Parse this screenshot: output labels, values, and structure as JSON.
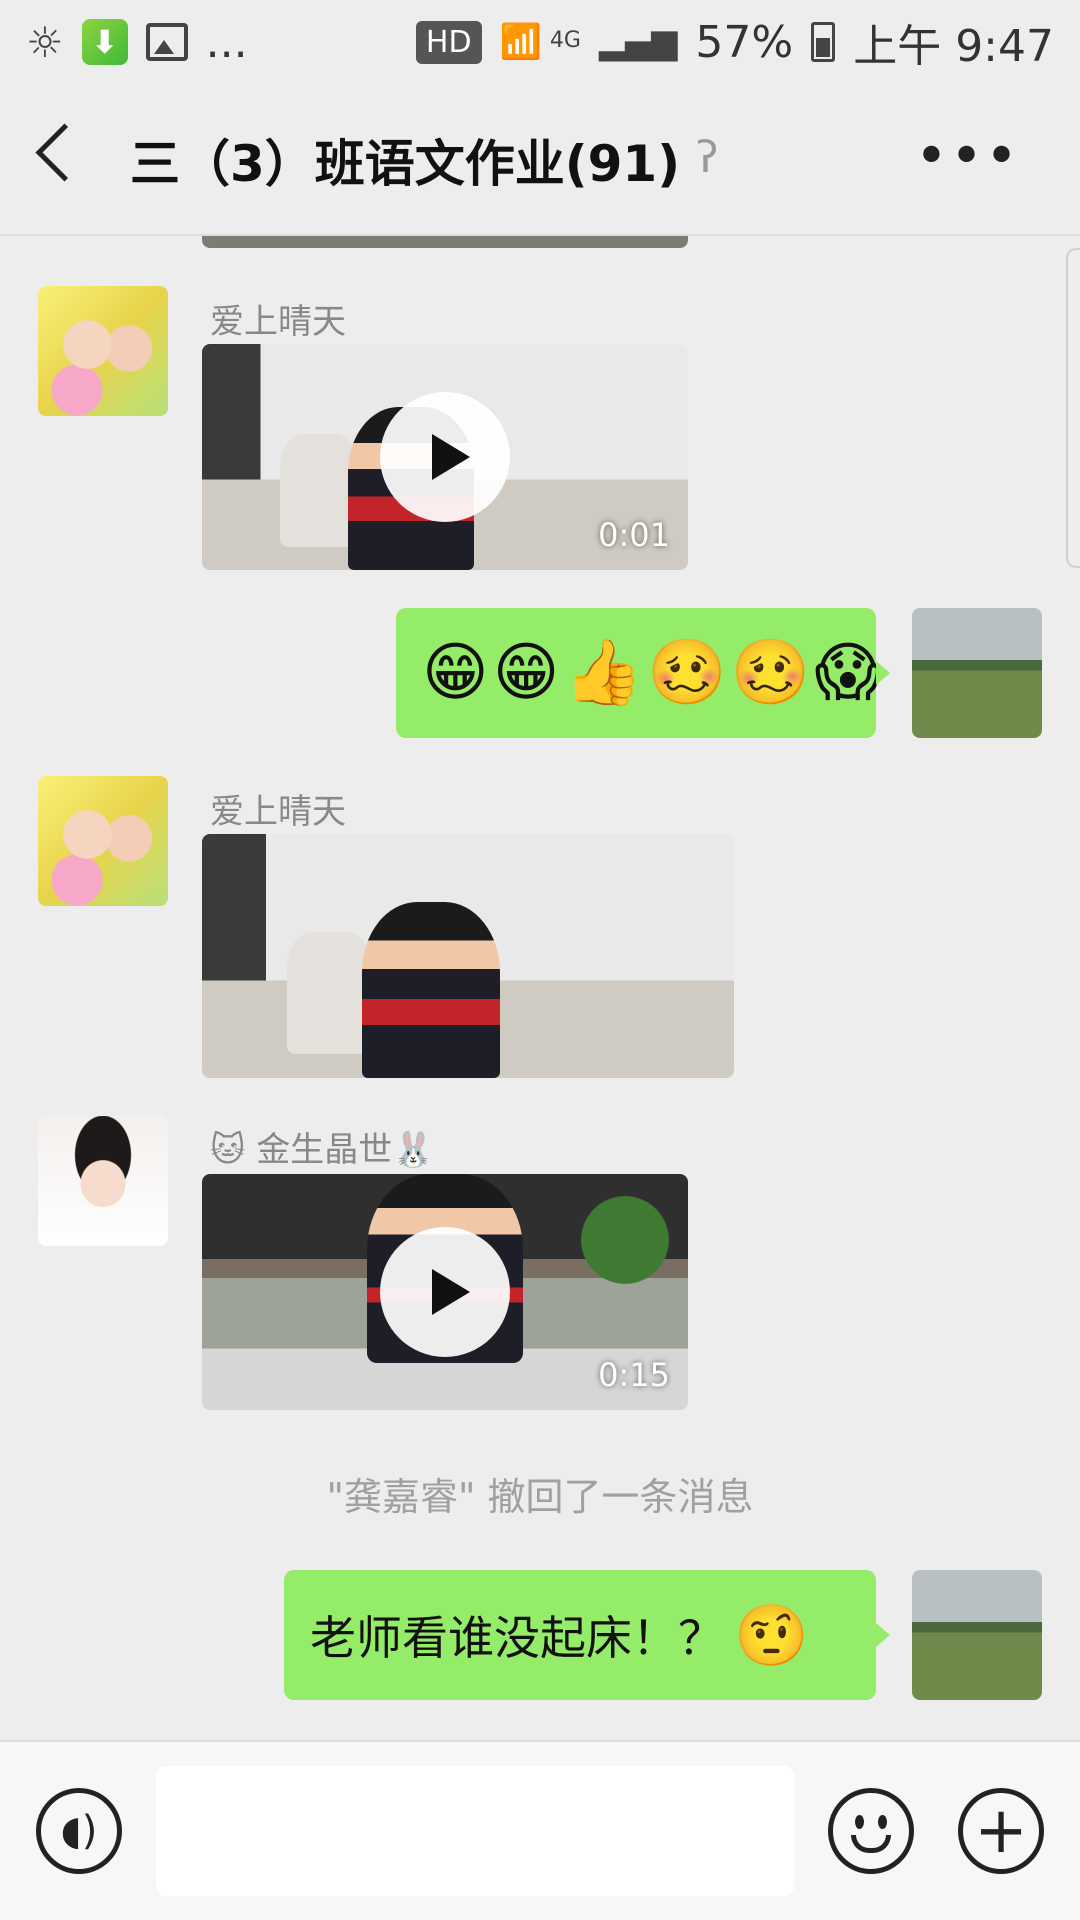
{
  "status_bar": {
    "icons": [
      "sun-icon",
      "download-icon",
      "image-icon"
    ],
    "more": "...",
    "hd": "HD",
    "network": "4G",
    "battery": "57%",
    "time": "上午 9:47"
  },
  "header": {
    "title": "三（3）班语文作业(91)",
    "back_icon": "chevron-left-icon",
    "mute_icon": "ear-icon",
    "more_icon": "more-dots-icon"
  },
  "messages": [
    {
      "type": "video",
      "direction": "in",
      "sender": "爱上晴天",
      "duration": "0:01",
      "has_play": true
    },
    {
      "type": "emoji",
      "direction": "out",
      "emojis": [
        "😁",
        "😁",
        "👍",
        "🥴",
        "🥴",
        "😱"
      ]
    },
    {
      "type": "video",
      "direction": "in",
      "sender": "爱上晴天",
      "duration": "",
      "has_play": false
    },
    {
      "type": "video",
      "direction": "in",
      "sender": "🐱 金生晶世🐰",
      "duration": "0:15",
      "has_play": true
    },
    {
      "type": "system",
      "text": "\"龚嘉睿\" 撤回了一条消息"
    },
    {
      "type": "text",
      "direction": "out",
      "text": "老师看谁没起床！？",
      "emoji": "🤨"
    }
  ],
  "input_bar": {
    "voice_icon": "voice-icon",
    "emoji_icon": "emoji-icon",
    "plus_icon": "plus-icon"
  },
  "colors": {
    "background": "#ededed",
    "outgoing_bubble": "#95ec69",
    "input_bar": "#f7f7f7"
  }
}
